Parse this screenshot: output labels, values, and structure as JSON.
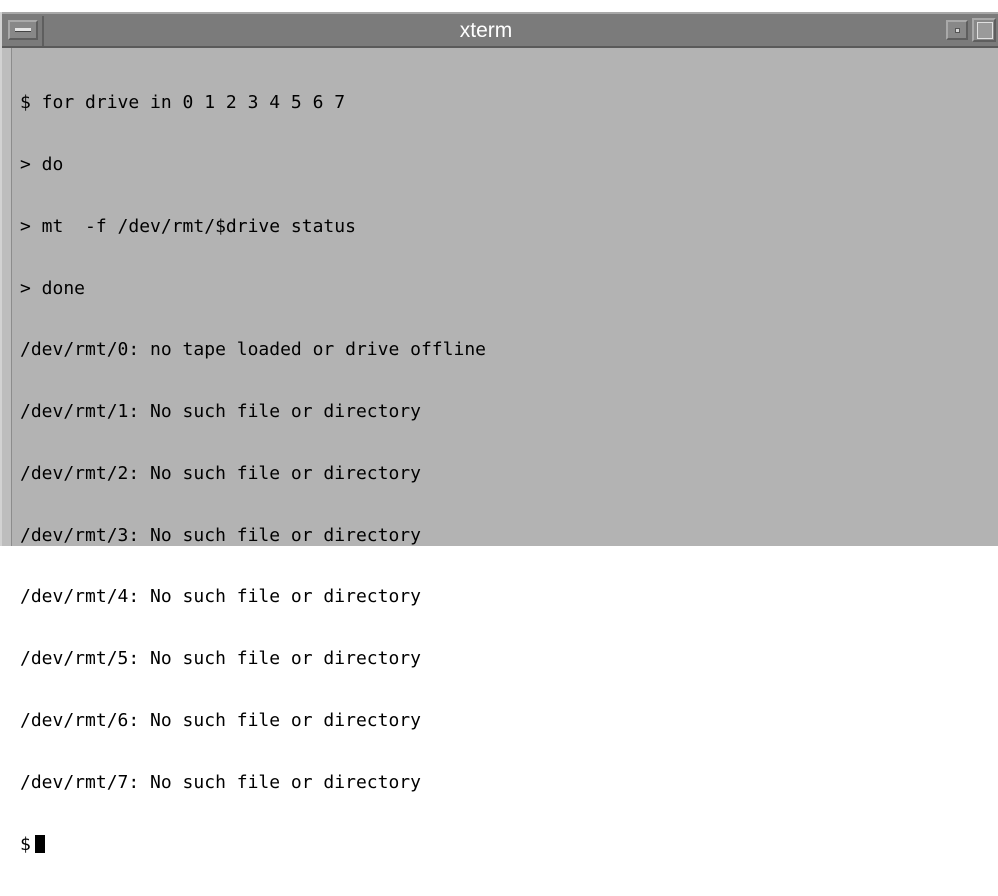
{
  "window": {
    "title": "xterm"
  },
  "terminal": {
    "lines": [
      "$ for drive in 0 1 2 3 4 5 6 7",
      "> do",
      "> mt  -f /dev/rmt/$drive status",
      "> done",
      "/dev/rmt/0: no tape loaded or drive offline",
      "/dev/rmt/1: No such file or directory",
      "/dev/rmt/2: No such file or directory",
      "/dev/rmt/3: No such file or directory",
      "/dev/rmt/4: No such file or directory",
      "/dev/rmt/5: No such file or directory",
      "/dev/rmt/6: No such file or directory",
      "/dev/rmt/7: No such file or directory"
    ],
    "prompt": "$"
  },
  "colors": {
    "terminal_bg": "#b3b3b3",
    "titlebar_bg": "#7b7b7b",
    "text": "#000000"
  },
  "icons": {
    "window_menu": "window-menu-icon",
    "minimize": "minimize-icon",
    "maximize": "maximize-icon"
  }
}
